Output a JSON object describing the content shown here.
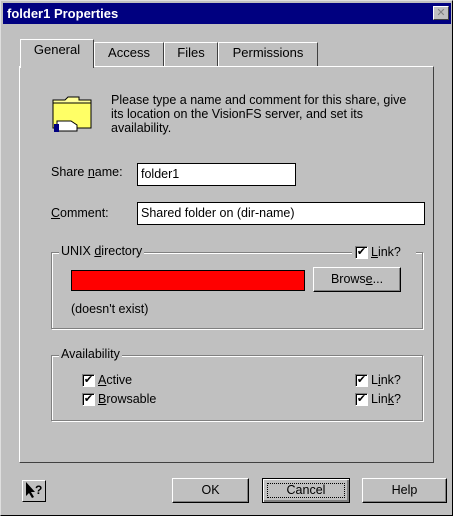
{
  "window": {
    "title": "folder1 Properties",
    "close_icon": "close-icon"
  },
  "tabs": [
    {
      "label": "General",
      "active": true
    },
    {
      "label": "Access"
    },
    {
      "label": "Files"
    },
    {
      "label": "Permissions"
    }
  ],
  "general": {
    "intro_text": "Please type a name and comment for this share, give its location on the VisionFS server, and set its availability.",
    "share_name": {
      "label_pre": "Share ",
      "label_u": "n",
      "label_post": "ame:",
      "value": "folder1"
    },
    "comment": {
      "label_u": "C",
      "label_post": "omment:",
      "value": "Shared folder on (dir-name)"
    },
    "unix_directory": {
      "title_pre": "UNIX ",
      "title_u": "d",
      "title_post": "irectory",
      "link_label_u": "L",
      "link_label_post": "ink?",
      "link_checked": true,
      "path_value": "",
      "path_color": "#ff0000",
      "status_text": "(doesn't exist)",
      "browse_pre": "Brows",
      "browse_u": "e",
      "browse_post": "..."
    },
    "availability": {
      "title": "Availability",
      "active": {
        "label_u": "A",
        "label_post": "ctive",
        "checked": true
      },
      "browsable": {
        "label_u": "B",
        "label_post": "rowsable",
        "checked": true
      },
      "link1": {
        "label_pre": "L",
        "label_u": "i",
        "label_post": "nk?",
        "checked": true
      },
      "link2": {
        "label_pre": "Lin",
        "label_u": "k",
        "label_post": "?",
        "checked": true
      }
    }
  },
  "footer": {
    "help_cursor_icon": "help-cursor-icon",
    "ok_label": "OK",
    "cancel_label": "Cancel",
    "help_label": "Help"
  }
}
